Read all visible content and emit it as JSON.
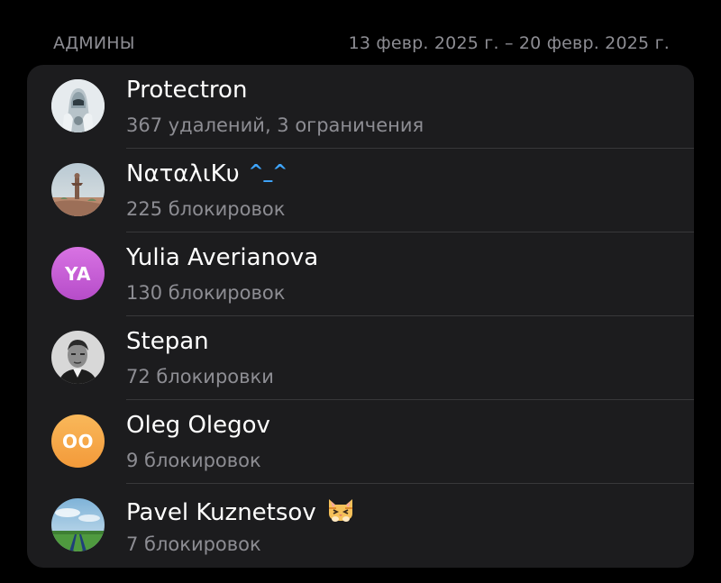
{
  "header": {
    "title": "АДМИНЫ",
    "date_range": "13 февр. 2025 г. – 20 февр. 2025 г."
  },
  "admins": [
    {
      "name": "Protectron",
      "stats": "367 удалений, 3 ограничения",
      "avatar_icon": "robot-icon"
    },
    {
      "name": "NαταλιKυ",
      "name_suffix": "^_^",
      "stats": "225 блокировок",
      "avatar_icon": "landscape-photo-icon"
    },
    {
      "name": "Yulia Averianova",
      "stats": "130 блокировок",
      "initials": "YA",
      "avatar_color": "#c85ad6"
    },
    {
      "name": "Stepan",
      "stats": "72 блокировки",
      "avatar_icon": "portrait-photo-icon"
    },
    {
      "name": "Oleg Olegov",
      "stats": "9 блокировок",
      "initials": "OO",
      "avatar_color": "#f6a243"
    },
    {
      "name": "Pavel Kuznetsov",
      "stats": "7 блокировок",
      "avatar_icon": "sky-photo-icon",
      "name_emoji": "cat-emoji-icon"
    }
  ],
  "colors": {
    "background": "#000000",
    "card": "#1c1c1e",
    "secondary_text": "#8d8d93",
    "accent_blue": "#3fa6ff"
  }
}
